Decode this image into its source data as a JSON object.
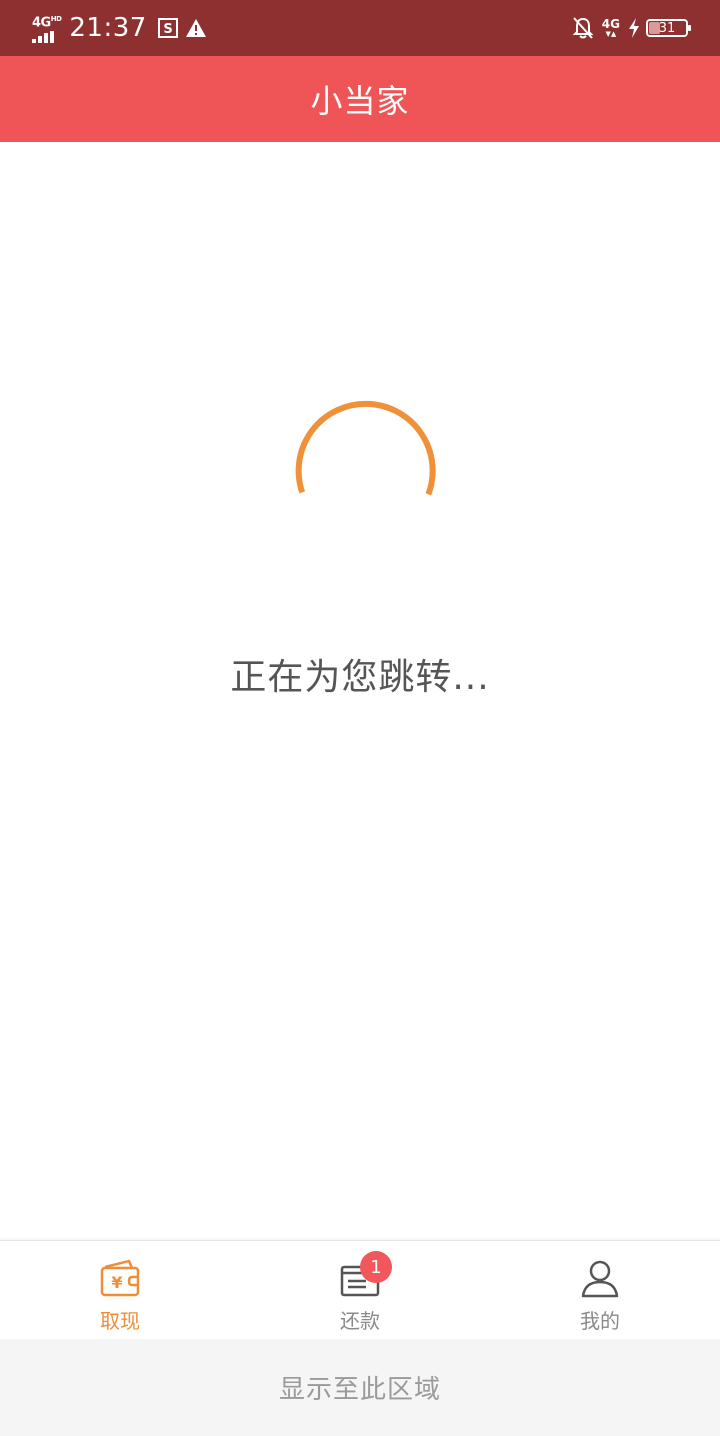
{
  "status_bar": {
    "network": "4G",
    "network_sup": "HD",
    "time": "21:37",
    "mobile_data": "4G",
    "battery": "31",
    "battery_level_fraction": 0.31,
    "icons": [
      "screenshot-icon",
      "warning-icon",
      "bell-off-icon",
      "charging-icon"
    ]
  },
  "app_bar": {
    "title": "小当家"
  },
  "main": {
    "loading_text": "正在为您跳转...",
    "spinner_color": "#f0913a"
  },
  "tabbar": {
    "tabs": [
      {
        "label": "取现",
        "icon": "wallet-icon",
        "active": true
      },
      {
        "label": "还款",
        "icon": "bill-icon",
        "active": false,
        "badge": "1"
      },
      {
        "label": "我的",
        "icon": "user-icon",
        "active": false
      }
    ]
  },
  "overlay": {
    "text": "显示至此区域"
  },
  "colors": {
    "status_bar": "#8e3030",
    "app_bar": "#ef5556",
    "accent": "#ef8d3a",
    "badge": "#f2575b"
  }
}
